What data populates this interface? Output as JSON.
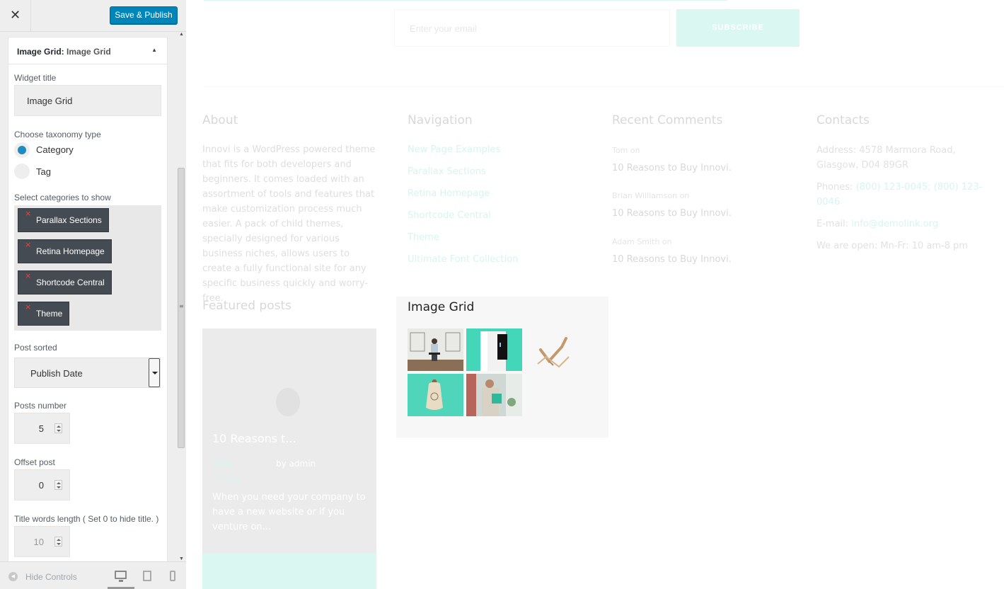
{
  "header": {
    "close_label": "✕",
    "publish_label": "Save & Publish"
  },
  "widget": {
    "title_prefix": "Image Grid:",
    "title_name": "Image Grid",
    "toggle_icon": "▲",
    "widget_title_label": "Widget title",
    "widget_title_value": "Image Grid",
    "taxonomy_label": "Choose taxonomy type",
    "taxonomy_options": [
      "Category",
      "Tag"
    ],
    "taxonomy_selected": "Category",
    "categories_label": "Select categories to show",
    "categories": [
      "Parallax Sections",
      "Retina Homepage",
      "Shortcode Central",
      "Theme"
    ],
    "chip_remove": "×",
    "sorted_label": "Post sorted",
    "sorted_value": "Publish Date",
    "posts_number_label": "Posts number",
    "posts_number_value": "5",
    "offset_label": "Offset post",
    "offset_value": "0",
    "title_words_label": "Title words length ( Set 0 to hide title. )",
    "title_words_value": "10"
  },
  "sidebar_scroll": {
    "up": "▲",
    "down": "▼",
    "grip": "≡"
  },
  "footer": {
    "hide_label": "Hide Controls",
    "hide_icon": "◀"
  },
  "preview": {
    "email_placeholder": "Enter your email",
    "subscribe_label": "SUBSCRIBE",
    "about": {
      "heading": "About",
      "text": "Innovi is a WordPress powered theme that fits for both developers and beginners. It comes loaded with an assortment of tools and features that make customization process much easier. A pack of child themes, specially designed for various business niches, allows users to create a fully functional site for any specific business quickly and worry-free."
    },
    "navigation": {
      "heading": "Navigation",
      "links": [
        "New Page Examples",
        "Parallax Sections",
        "Retina Homepage",
        "Shortcode Central",
        "Theme",
        "Ultimate Font Collection"
      ]
    },
    "recent_comments": {
      "heading": "Recent Comments",
      "items": [
        {
          "meta": "Tom  on",
          "title": "10 Reasons to Buy Innovi."
        },
        {
          "meta": "Brian Williamson  on",
          "title": "10 Reasons to Buy Innovi."
        },
        {
          "meta": "Adam Smith  on",
          "title": "10 Reasons to Buy Innovi."
        }
      ]
    },
    "contacts": {
      "heading": "Contacts",
      "address": "Address: 4578 Marmora Road, Glasgow, D04 89GR",
      "phones_label": "Phones:",
      "phones_value": "(800) 123-0045; (800) 123-0046",
      "email_label": "E-mail:",
      "email_value": "info@demolink.org",
      "hours": "We are open: Mn-Fr: 10 am-8 pm"
    },
    "featured": {
      "heading": "Featured posts",
      "post_title": "10 Reasons t...",
      "post_date": "2016",
      "post_author": "by admin",
      "post_category": "Theme",
      "post_excerpt": "When you need your company to have a new website or if you venture on..."
    },
    "image_grid": {
      "heading": "Image Grid"
    }
  },
  "colors": {
    "accent": "#0085ba",
    "chip": "#454b53",
    "teal": "#2ed1b6",
    "radio_on": "#1e8cbe"
  }
}
